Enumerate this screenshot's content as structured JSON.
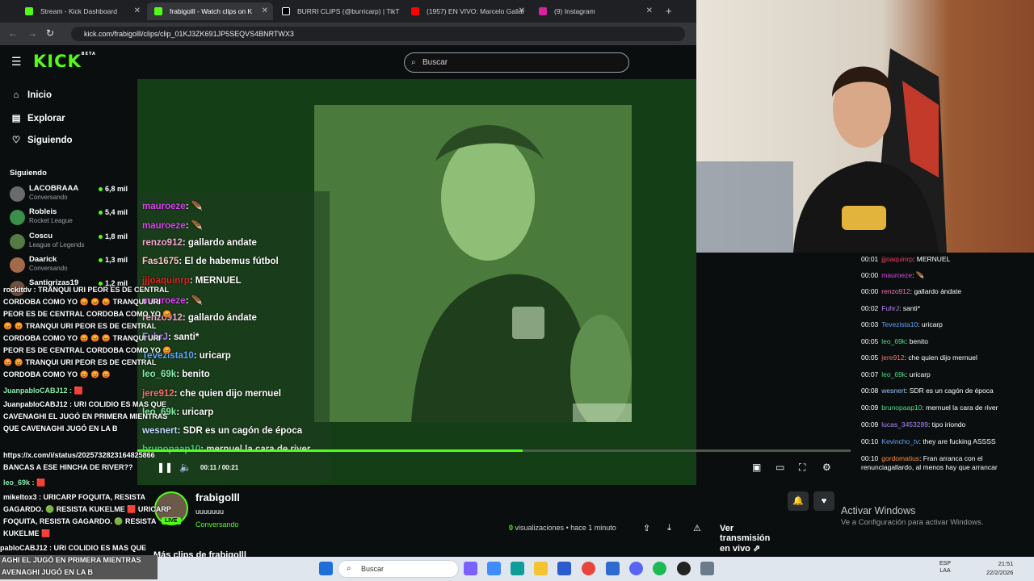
{
  "tabs": [
    {
      "title": "Stream - Kick Dashboard",
      "color": "#53fc18",
      "active": false
    },
    {
      "title": "frabigolll - Watch clips on K",
      "color": "#53fc18",
      "active": true
    },
    {
      "title": "BURRI CLIPS (@burricarp) | TikT",
      "color": "#ffffff",
      "active": false
    },
    {
      "title": "(1957) EN VIVO: Marcelo Gallar",
      "color": "#ff0000",
      "active": false
    },
    {
      "title": "(9) Instagram",
      "color": "#d6249f",
      "active": false
    }
  ],
  "url": "kick.com/frabigolll/clips/clip_01KJ3ZK691JP5SEQVS4BNRTWX3",
  "search_placeholder": "Buscar",
  "nav": {
    "inicio": "Inicio",
    "explorar": "Explorar",
    "siguiendo": "Siguiendo"
  },
  "following_title": "Siguiendo",
  "following": [
    {
      "name": "LACOBRAAA",
      "category": "Conversando",
      "viewers": "6,8 mil"
    },
    {
      "name": "Robleis",
      "category": "Rocket League",
      "viewers": "5,4 mil"
    },
    {
      "name": "Coscu",
      "category": "League of Legends",
      "viewers": "1,8 mil"
    },
    {
      "name": "Daarick",
      "category": "Conversando",
      "viewers": "1,3 mil"
    },
    {
      "name": "Santigrizas19",
      "category": "",
      "viewers": "1,2 mil"
    }
  ],
  "overlay_chat": [
    {
      "user": "mauroeze",
      "color": "#d946ef",
      "text": ": 🪶"
    },
    {
      "user": "mauroeze",
      "color": "#d946ef",
      "text": ": 🪶"
    },
    {
      "user": "renzo912",
      "color": "#f472b6",
      "text": ": gallardo andate"
    },
    {
      "user": "Fas1675",
      "color": "#fca5a5",
      "text": ": El de habemus fútbol"
    },
    {
      "user": "jjjoaquinrp",
      "color": "#dc2626",
      "text": ": MERNUEL"
    },
    {
      "user": "mauroeze",
      "color": "#d946ef",
      "text": ": 🪶"
    },
    {
      "user": "renzo912",
      "color": "#f472b6",
      "text": ": gallardo ándate"
    },
    {
      "user": "FuhrJ",
      "color": "#c084fc",
      "text": ": santi*"
    },
    {
      "user": "Tevezista10",
      "color": "#60a5fa",
      "text": ": uricarp"
    },
    {
      "user": "leo_69k",
      "color": "#4ade80",
      "text": ": benito"
    },
    {
      "user": "jere912",
      "color": "#f87171",
      "text": ": che quien dijo mernuel"
    },
    {
      "user": "leo_69k",
      "color": "#4ade80",
      "text": ": uricarp"
    },
    {
      "user": "wesnert",
      "color": "#93c5fd",
      "text": ": SDR es un cagón de época"
    },
    {
      "user": "brunopaap10",
      "color": "#4ade80",
      "text": ": mernuel la cara de river"
    }
  ],
  "player": {
    "time": "00:11 / 00:21",
    "progress": 0.54
  },
  "channel": {
    "name": "frabigolll",
    "title": "uuuuuuu",
    "category": "Conversando",
    "live": "LIVE"
  },
  "views": {
    "count": "0",
    "label": "visualizaciones",
    "ago": "• hace 1 minuto"
  },
  "watch_live": "Ver transmisión en vivo",
  "right_chat": [
    {
      "time": "00:01",
      "user": "jjjoaquinrp",
      "color": "#f43f5e",
      "text": ": MERNUEL"
    },
    {
      "time": "00:00",
      "user": "mauroeze",
      "color": "#d946ef",
      "text": ": 🪶"
    },
    {
      "time": "00:00",
      "user": "renzo912",
      "color": "#f472b6",
      "text": ": gallardo ándate"
    },
    {
      "time": "00:02",
      "user": "FuhrJ",
      "color": "#c084fc",
      "text": ": santi*"
    },
    {
      "time": "00:03",
      "user": "Tevezista10",
      "color": "#60a5fa",
      "text": ": uricarp"
    },
    {
      "time": "00:05",
      "user": "leo_69k",
      "color": "#4ade80",
      "text": ": benito"
    },
    {
      "time": "00:05",
      "user": "jere912",
      "color": "#f87171",
      "text": ": che quien dijo mernuel"
    },
    {
      "time": "00:07",
      "user": "leo_69k",
      "color": "#4ade80",
      "text": ": uricarp"
    },
    {
      "time": "00:08",
      "user": "wesnert",
      "color": "#93c5fd",
      "text": ": SDR es un cagón de época"
    },
    {
      "time": "00:09",
      "user": "brunopaap10",
      "color": "#4ade80",
      "text": ": mernuel la cara de river"
    },
    {
      "time": "00:09",
      "user": "lucas_3453289",
      "color": "#a78bfa",
      "text": ": tipo iriondo"
    },
    {
      "time": "00:10",
      "user": "Kevincho_tv",
      "color": "#60a5fa",
      "text": ": they are fucking ASSSS"
    },
    {
      "time": "00:10",
      "user": "gordomatius",
      "color": "#fb923c",
      "text": ": Fran arranca con el renunciagallardo, al menos hay que arrancar"
    }
  ],
  "left_overlay": [
    {
      "text": "rockitdv : TRANQUI URI PEOR ES DE CENTRAL"
    },
    {
      "text": "CORDOBA COMO YO 😡 😡 😡 TRANQUI URI"
    },
    {
      "text": "PEOR ES DE CENTRAL CORDOBA COMO YO 😡"
    },
    {
      "text": "😡 😡 TRANQUI URI PEOR ES DE CENTRAL"
    },
    {
      "text": "CORDOBA COMO YO 😡 😡 😡 TRANQUI URI"
    },
    {
      "text": "PEOR ES DE CENTRAL CORDOBA COMO YO 😡"
    },
    {
      "text": "😡 😡 TRANQUI URI PEOR ES DE CENTRAL"
    },
    {
      "text": "CORDOBA COMO YO 😡 😡 😡"
    },
    {
      "text": "JuanpabloCABJ12 : 🟥"
    },
    {
      "text": "JuanpabloCABJ12 : URI COLIDIO ES MAS QUE"
    },
    {
      "text": "CAVENAGHI EL JUGÓ EN PRIMERA MIENTRAS"
    },
    {
      "text": "QUE CAVENAGHI JUGÓ EN LA B"
    },
    {
      "text": "https://x.com/i/status/2025732823164825866"
    },
    {
      "text": "BANCAS A ESE HINCHA DE RIVER??"
    },
    {
      "text": "leo_69k : 🟥"
    },
    {
      "text": "mikeltox3 : URICARP FOQUITA, RESISTA"
    },
    {
      "text": "GAGARDO. 🟢 RESISTA KUKELME 🟥 URICARP"
    },
    {
      "text": "FOQUITA, RESISTA GAGARDO. 🟢 RESISTA"
    },
    {
      "text": "KUKELME 🟥"
    },
    {
      "text": "pabloCABJ12 : URI COLIDIO ES MAS QUE"
    },
    {
      "text": "AGHI EL JUGÓ EN PRIMERA MIENTRAS"
    },
    {
      "text": "AVENAGHI JUGÓ EN LA B"
    }
  ],
  "activate": {
    "title": "Activar Windows",
    "subtitle": "Ve a Configuración para activar Windows."
  },
  "taskbar": {
    "search": "Buscar",
    "lang1": "ESP",
    "lang2": "LAA",
    "time": "21:51",
    "date": "22/2/2026"
  },
  "more_clips": "Más clips de frabigolll"
}
